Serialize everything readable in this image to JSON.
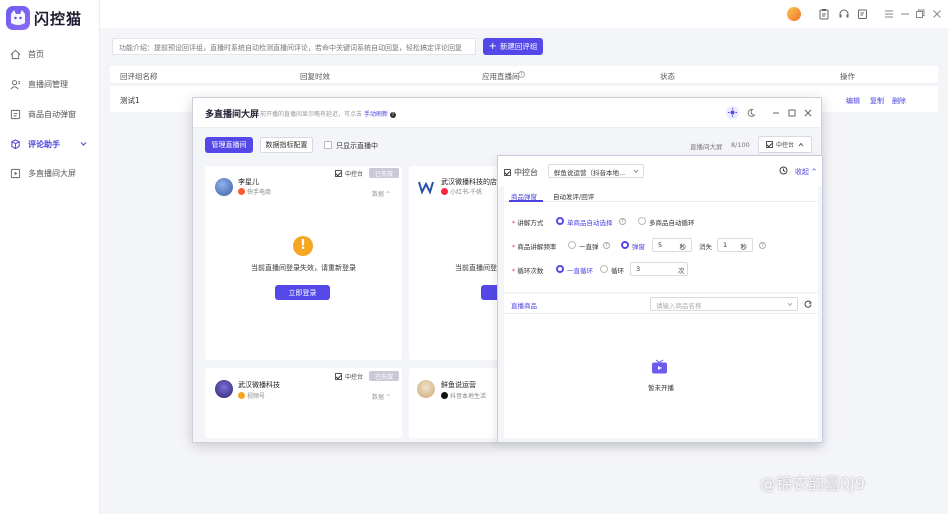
{
  "app": {
    "name": "闪控猫"
  },
  "sidebar": {
    "items": [
      {
        "label": "首页",
        "icon": "home-icon"
      },
      {
        "label": "直播间管理",
        "icon": "user-icon"
      },
      {
        "label": "商品自动弹窗",
        "icon": "popup-icon"
      },
      {
        "label": "评论助手",
        "icon": "comment-icon",
        "active": true
      },
      {
        "label": "多直播间大屏",
        "icon": "play-icon"
      }
    ]
  },
  "main": {
    "intro": "功能介绍：提前预设回评组，直播时系统自动检测直播间评论，若命中关键词系统自动回复，轻松搞定评论回复",
    "new_button": "新建回评组",
    "table": {
      "headers": [
        "回评组名称",
        "回复时效",
        "应用直播间",
        "状态",
        "操作"
      ],
      "row": {
        "name": "测试1",
        "actions": [
          "编辑",
          "复制",
          "删除"
        ]
      }
    }
  },
  "modal": {
    "title": "多直播间大屏",
    "subtitle": "前开播的直播间显示略有延迟，可点击",
    "refresh_link": "手动刷新",
    "manage_btn": "管理直播间",
    "metrics_btn": "数据指标配置",
    "only_live_label": "只显示直播中",
    "screen_count_label": "直播间大屏",
    "screen_count": "8/100",
    "control_label": "中控台",
    "cards": [
      {
        "name": "李星儿",
        "platform": "快手电商",
        "ctrl": "中控台",
        "tag": "已失效",
        "collapse": "数据",
        "message": "当前直播间登录失效，请重新登录",
        "login_btn": "立即登录"
      },
      {
        "name": "武汉微播科技的店",
        "platform": "小红书-千帆",
        "message": "当前直播间登"
      },
      {
        "name": "武汉微播科技",
        "platform": "视频号",
        "ctrl": "中控台",
        "tag": "已失效",
        "collapse": "数据"
      },
      {
        "name": "鲜鱼说运营",
        "platform": "抖音本地生活"
      }
    ]
  },
  "panel": {
    "title": "中控台",
    "account_select": "鲜鱼说运营（抖音本地...",
    "collapse_label": "收起",
    "tabs": [
      "商品弹窗",
      "自动发评/回评"
    ],
    "explain_mode_label": "讲解方式",
    "explain_opt1": "单商品自动选择",
    "explain_opt2": "多商品自动循环",
    "freq_label": "商品讲解频率",
    "freq_opt1": "一直弹",
    "freq_opt2": "弹窗",
    "freq_value": "5",
    "sec1": "秒",
    "vanish_label": "消失",
    "vanish_value": "1",
    "sec2": "秒",
    "loop_label": "循环次数",
    "loop_opt1": "一直循环",
    "loop_opt2": "循环",
    "loop_value": "3",
    "loop_unit": "次",
    "goods_label": "直播商品",
    "goods_placeholder": "请输入商品名称",
    "empty_text": "暂未开播"
  },
  "watermark": "@锦衣韵嘉0J9",
  "colors": {
    "accent": "#5448e8",
    "warn": "#f5a623",
    "danger": "#e5484d"
  }
}
